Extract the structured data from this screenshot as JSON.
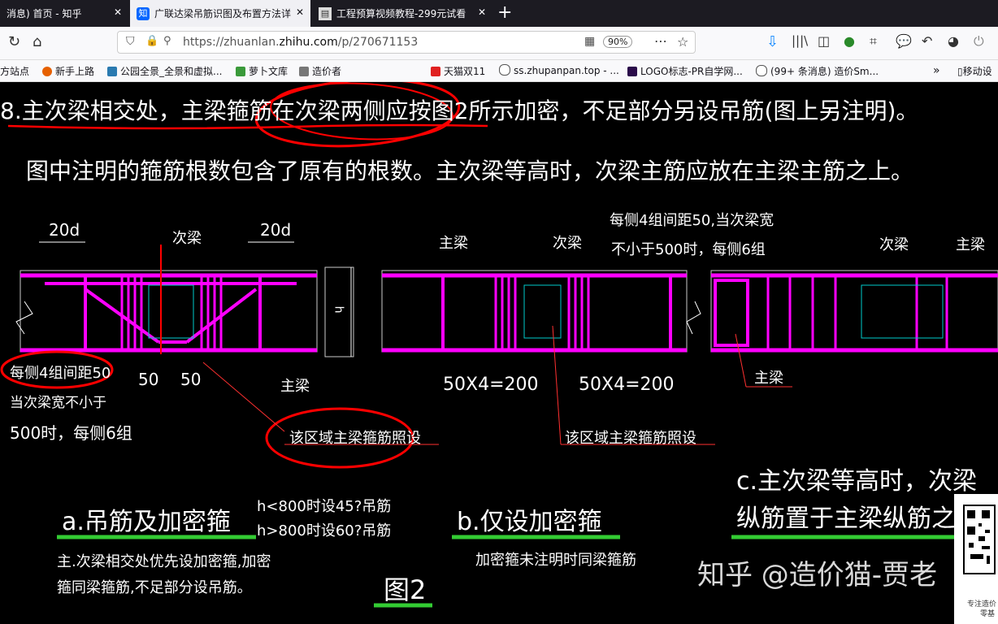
{
  "tabs": [
    {
      "label": "消息) 首页 - 知乎",
      "active": false
    },
    {
      "label": "广联达梁吊筋识图及布置方法详",
      "active": true
    },
    {
      "label": "工程预算视频教程-299元试看",
      "active": false
    }
  ],
  "nav": {
    "url_prefix": "https://zhuanlan.",
    "url_domain": "zhihu.com",
    "url_path": "/p/270671153",
    "zoom": "90%"
  },
  "bookmarks": [
    "方站点",
    "新手上路",
    "公园全景_全景和虚拟...",
    "萝卜文库",
    "造价者",
    "天猫双11",
    "ss.zhupanpan.top - ...",
    "LOGO标志-PR自学网...",
    "(99+ 条消息) 造价Sm...",
    "移动设"
  ],
  "drawing": {
    "heading_line1": "8.主次梁相交处，主梁箍筋在次梁两侧应按图2所示加密，不足部分另设吊筋(图上另注明)。",
    "heading_line2": "图中注明的箍筋根数包含了原有的根数。主次梁等高时，次梁主筋应放在主梁主筋之上。",
    "dim_20d_left": "20d",
    "dim_20d_right": "20d",
    "label_ciliang_a": "次梁",
    "label_zhuliang_b": "主梁",
    "label_ciliang_b": "次梁",
    "note_b_top1": "每侧4组间距50,当次梁宽",
    "note_b_top2": "不小于500时，每侧6组",
    "label_ciliang_c": "次梁",
    "label_zhuliang_c": "主梁",
    "h_mark": "h",
    "note_a_side1": "每侧4组间距50",
    "note_a_side2": "当次梁宽不小于",
    "note_a_side3": "500时，每侧6组",
    "dim_50_1": "50",
    "dim_50_2": "50",
    "label_zhuliang_a": "主梁",
    "dim_b_1": "50X4=200",
    "dim_b_2": "50X4=200",
    "label_zhuliang_c2": "主梁",
    "area_note_a": "该区域主梁箍筋照设",
    "area_note_b": "该区域主梁箍筋照设",
    "caption_a": "a.吊筋及加密箍",
    "hanger_note1": "h<800时设45?吊筋",
    "hanger_note2": "h>800时设60?吊筋",
    "caption_b": "b.仅设加密箍",
    "caption_c1": "c.主次梁等高时，次梁",
    "caption_c2": "纵筋置于主梁纵筋之上",
    "desc_a1": "主.次梁相交处优先设加密箍,加密",
    "desc_a2": "箍同梁箍筋,不足部分设吊筋。",
    "desc_b": "加密箍未注明时同梁箍筋",
    "figure_label": "图2",
    "watermark": "知乎 @造价猫-贾老",
    "qr_caption1": "专注造价",
    "qr_caption2": "零基"
  },
  "colors": {
    "rebar": "#ff00ff",
    "annotation": "#ff0000",
    "underline": "#33cc33",
    "background": "#000000"
  }
}
